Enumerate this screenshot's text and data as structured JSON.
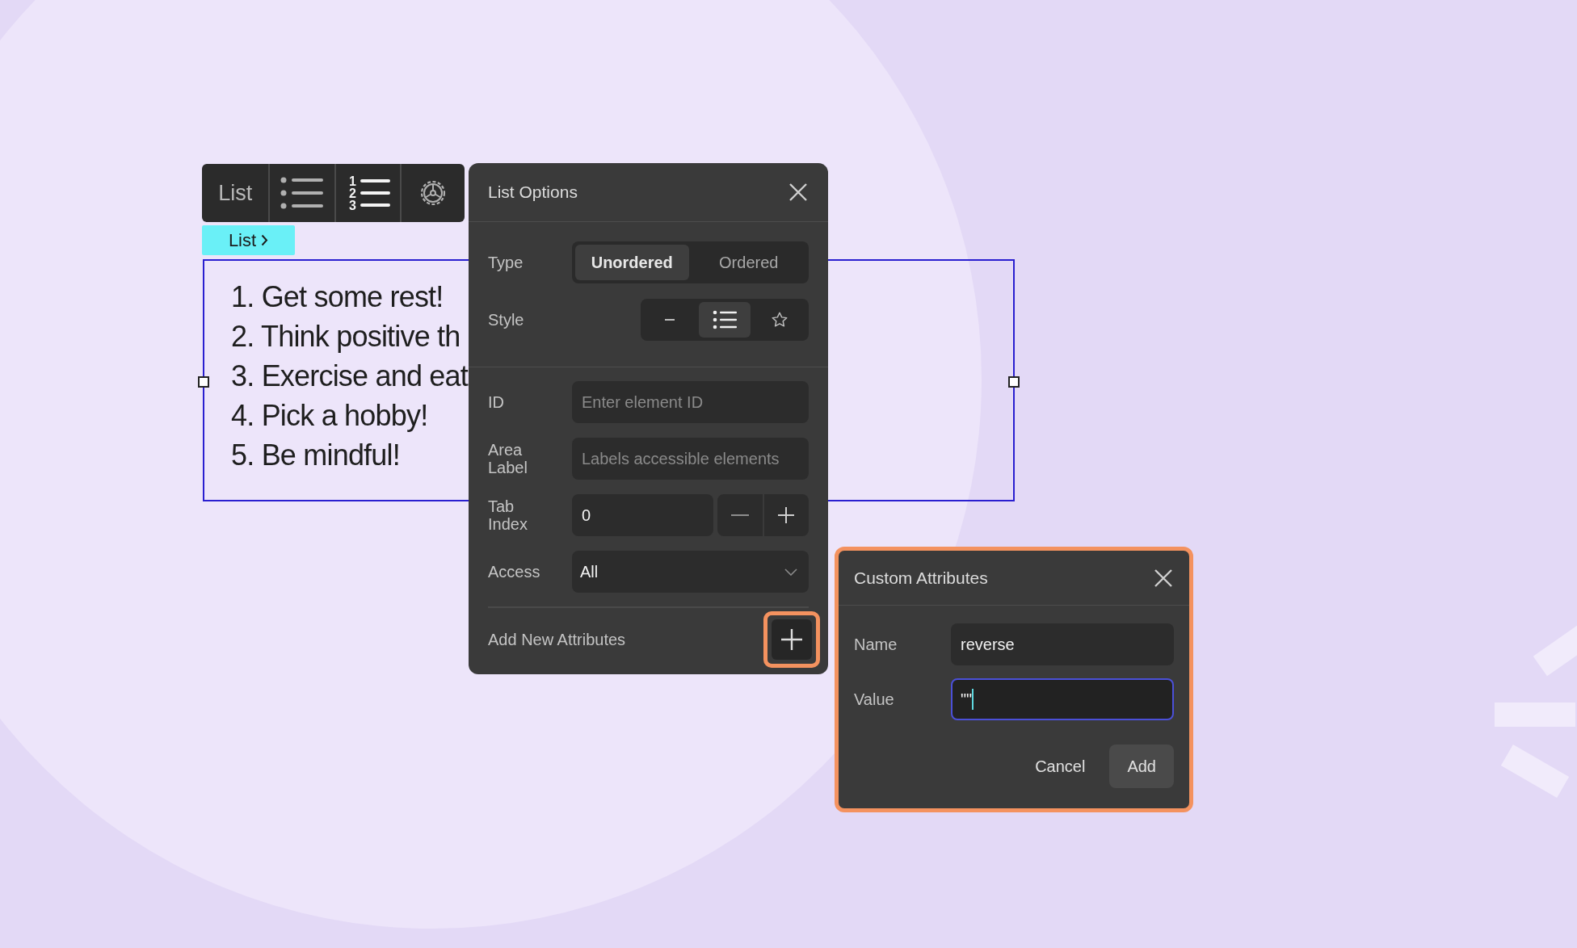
{
  "toolbar": {
    "label": "List",
    "buttons": [
      {
        "kind": "bulleted",
        "selected": false
      },
      {
        "kind": "numbered",
        "selected": true,
        "digits": [
          "1",
          "2",
          "3"
        ]
      },
      {
        "kind": "settings",
        "selected": false
      }
    ]
  },
  "breadcrumb": {
    "label": "List"
  },
  "list_items": [
    {
      "number": "1.",
      "text": "Get some rest!"
    },
    {
      "number": "2.",
      "text": "Think positive th"
    },
    {
      "number": "3.",
      "text": "Exercise and eat"
    },
    {
      "number": "4.",
      "text": "Pick a hobby!"
    },
    {
      "number": "5.",
      "text": "Be mindful!"
    }
  ],
  "list_options": {
    "title": "List Options",
    "type": {
      "label": "Type",
      "options": [
        {
          "label": "Unordered",
          "selected": true
        },
        {
          "label": "Ordered",
          "selected": false
        }
      ]
    },
    "style": {
      "label": "Style",
      "options": [
        {
          "kind": "dash",
          "selected": false
        },
        {
          "kind": "bullets",
          "selected": true
        },
        {
          "kind": "star",
          "selected": false
        }
      ]
    },
    "id": {
      "label": "ID",
      "placeholder": "Enter element ID"
    },
    "area_label": {
      "label": "Area Label",
      "placeholder": "Labels accessible elements"
    },
    "tab_index": {
      "label": "Tab Index",
      "value": "0"
    },
    "access": {
      "label": "Access",
      "value": "All"
    },
    "add_attributes": {
      "label": "Add New Attributes",
      "highlighted": true
    }
  },
  "custom_attributes": {
    "title": "Custom Attributes",
    "highlighted": true,
    "name": {
      "label": "Name",
      "value": "reverse",
      "focused": false
    },
    "value": {
      "label": "Value",
      "value": "\"\"",
      "focused": true
    },
    "buttons": [
      {
        "label": "Cancel",
        "kind": "text"
      },
      {
        "label": "Add",
        "kind": "filled"
      }
    ]
  }
}
